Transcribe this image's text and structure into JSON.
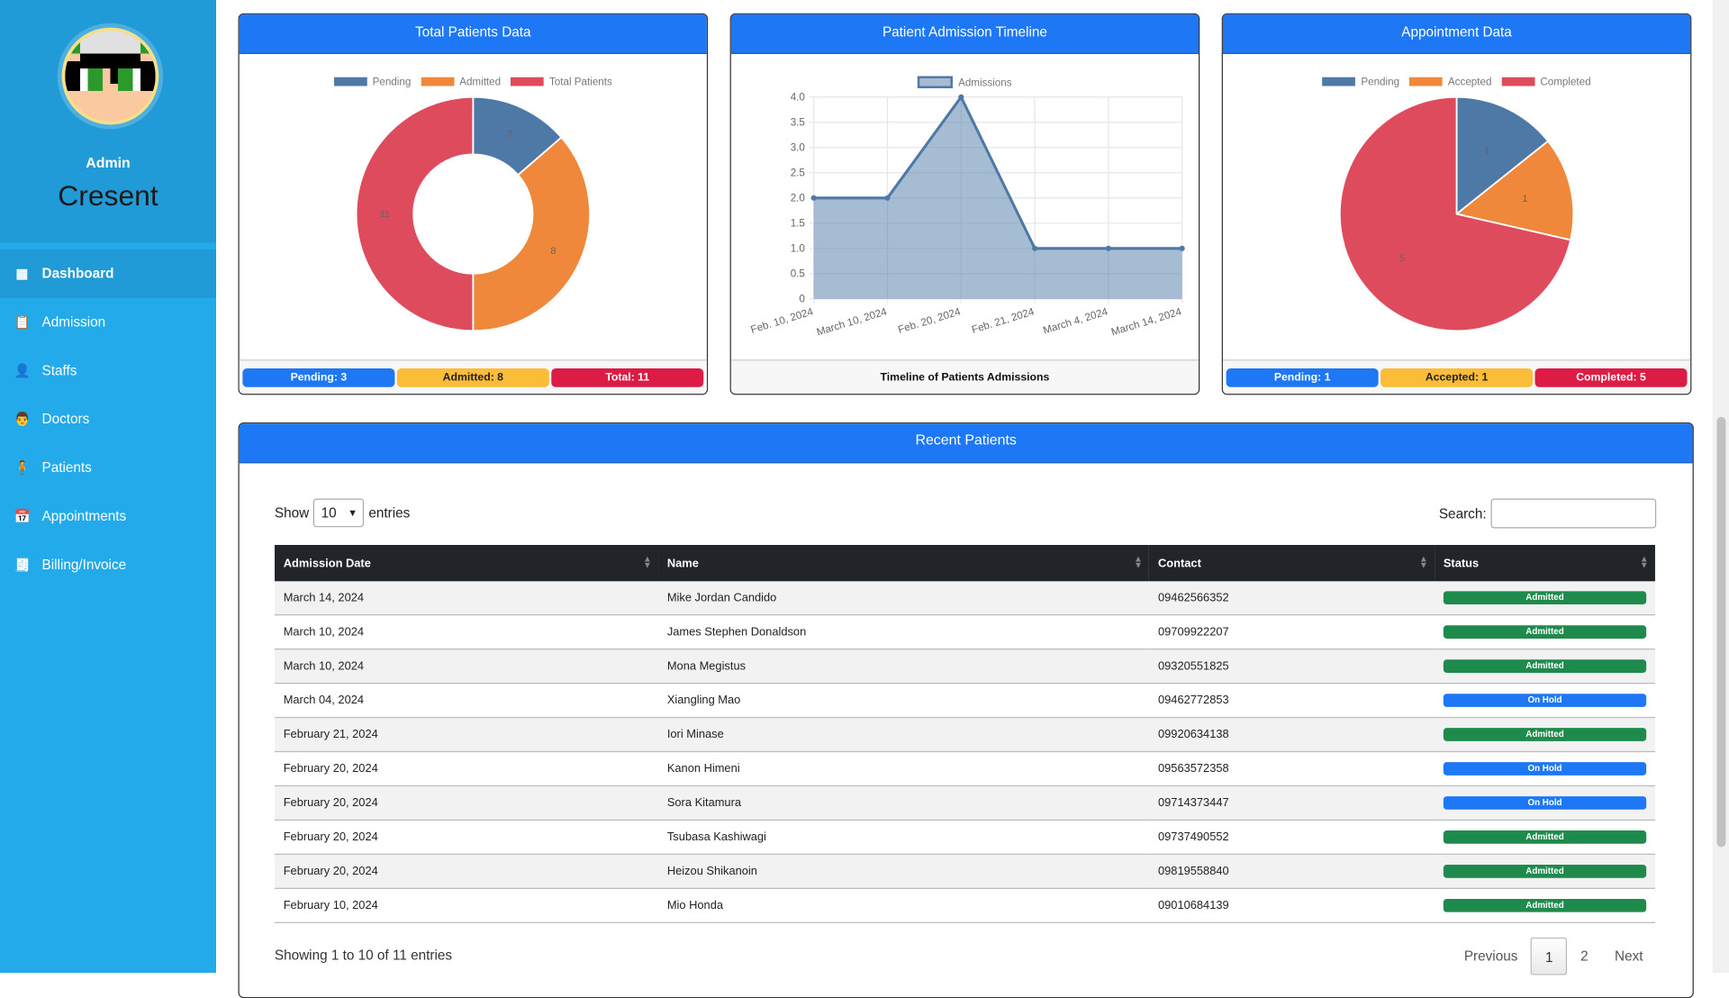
{
  "sidebar": {
    "role": "Admin",
    "name": "Cresent",
    "items": [
      {
        "label": "Dashboard",
        "icon": "dashboard-icon",
        "active": true
      },
      {
        "label": "Admission",
        "icon": "clipboard-icon"
      },
      {
        "label": "Staffs",
        "icon": "staff-icon"
      },
      {
        "label": "Doctors",
        "icon": "doctor-icon"
      },
      {
        "label": "Patients",
        "icon": "patient-icon"
      },
      {
        "label": "Appointments",
        "icon": "calendar-icon"
      },
      {
        "label": "Billing/Invoice",
        "icon": "invoice-icon"
      }
    ]
  },
  "cards": {
    "patients": {
      "title": "Total Patients Data",
      "badges": [
        "Pending: 3",
        "Admitted: 8",
        "Total: 11"
      ]
    },
    "timeline": {
      "title": "Patient Admission Timeline",
      "caption": "Timeline of Patients Admissions"
    },
    "appointments": {
      "title": "Appointment Data",
      "badges": [
        "Pending: 1",
        "Accepted: 1",
        "Completed: 5"
      ]
    }
  },
  "colors": {
    "primary": "#1e77f5",
    "warning": "#fbbc38",
    "danger": "#dc1c44",
    "success": "#1e8a4c",
    "pending": "#4e79a7",
    "orange": "#f0883c",
    "red": "#de4b5c"
  },
  "chart_data": [
    {
      "type": "pie",
      "variant": "doughnut",
      "categories": [
        "Pending",
        "Admitted",
        "Total Patients"
      ],
      "values": [
        3,
        8,
        11
      ],
      "legend": "top",
      "colors": [
        "#4e79a7",
        "#f0883c",
        "#de4b5c"
      ]
    },
    {
      "type": "area",
      "x": [
        "Feb. 10, 2024",
        "March 10, 2024",
        "Feb. 20, 2024",
        "Feb. 21, 2024",
        "March 4, 2024",
        "March 14, 2024"
      ],
      "series": [
        {
          "name": "Admissions",
          "values": [
            2,
            2,
            4,
            1,
            1,
            1
          ]
        }
      ],
      "ylim": [
        0,
        4
      ],
      "yticks": [
        "0",
        "0.5",
        "1.0",
        "1.5",
        "2.0",
        "2.5",
        "3.0",
        "3.5",
        "4.0"
      ],
      "grid": true,
      "legend": "top"
    },
    {
      "type": "pie",
      "categories": [
        "Pending",
        "Accepted",
        "Completed"
      ],
      "values": [
        1,
        1,
        5
      ],
      "legend": "top",
      "colors": [
        "#4e79a7",
        "#f0883c",
        "#de4b5c"
      ]
    }
  ],
  "recent": {
    "title": "Recent Patients",
    "show": "Show",
    "entries": "entries",
    "length": "10",
    "search_label": "Search:",
    "search_value": "",
    "columns": [
      "Admission Date",
      "Name",
      "Contact",
      "Status"
    ],
    "rows": [
      [
        "March 14, 2024",
        "Mike Jordan Candido",
        "09462566352",
        "Admitted"
      ],
      [
        "March 10, 2024",
        "James Stephen Donaldson",
        "09709922207",
        "Admitted"
      ],
      [
        "March 10, 2024",
        "Mona Megistus",
        "09320551825",
        "Admitted"
      ],
      [
        "March 04, 2024",
        "Xiangling Mao",
        "09462772853",
        "On Hold"
      ],
      [
        "February 21, 2024",
        "Iori Minase",
        "09920634138",
        "Admitted"
      ],
      [
        "February 20, 2024",
        "Kanon Himeni",
        "09563572358",
        "On Hold"
      ],
      [
        "February 20, 2024",
        "Sora Kitamura",
        "09714373447",
        "On Hold"
      ],
      [
        "February 20, 2024",
        "Tsubasa Kashiwagi",
        "09737490552",
        "Admitted"
      ],
      [
        "February 20, 2024",
        "Heizou Shikanoin",
        "09819558840",
        "Admitted"
      ],
      [
        "February 10, 2024",
        "Mio Honda",
        "09010684139",
        "Admitted"
      ]
    ],
    "info": "Showing 1 to 10 of 11 entries",
    "pager": [
      "Previous",
      "1",
      "2",
      "Next"
    ]
  }
}
